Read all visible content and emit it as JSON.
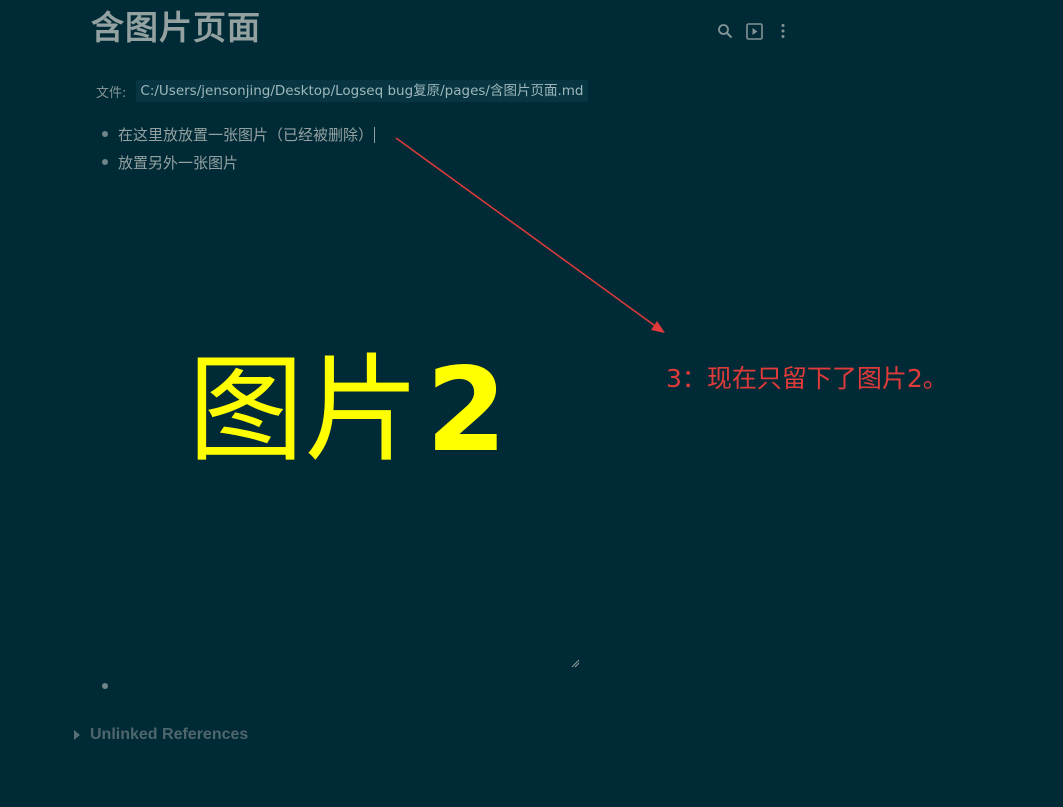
{
  "page": {
    "title": "含图片页面"
  },
  "toolbar": {
    "search_icon": "search-icon",
    "slideshow_icon": "presentation-icon",
    "more_icon": "more-vertical-icon"
  },
  "file": {
    "label": "文件:",
    "path": "C:/Users/jensonjing/Desktop/Logseq bug复原/pages/含图片页面.md"
  },
  "blocks": [
    {
      "text": "在这里放放置一张图片（已经被删除）"
    },
    {
      "text": "放置另外一张图片"
    }
  ],
  "image": {
    "caption_text": "图片",
    "caption_number": "2",
    "caption_color": "#ffff00"
  },
  "references": {
    "unlinked_label": "Unlinked References"
  },
  "annotation": {
    "text": "3：现在只留下了图片2。",
    "color": "#e03a3a"
  },
  "colors": {
    "background": "#002b36",
    "title": "#93a1a1",
    "path_bg": "#073642"
  }
}
